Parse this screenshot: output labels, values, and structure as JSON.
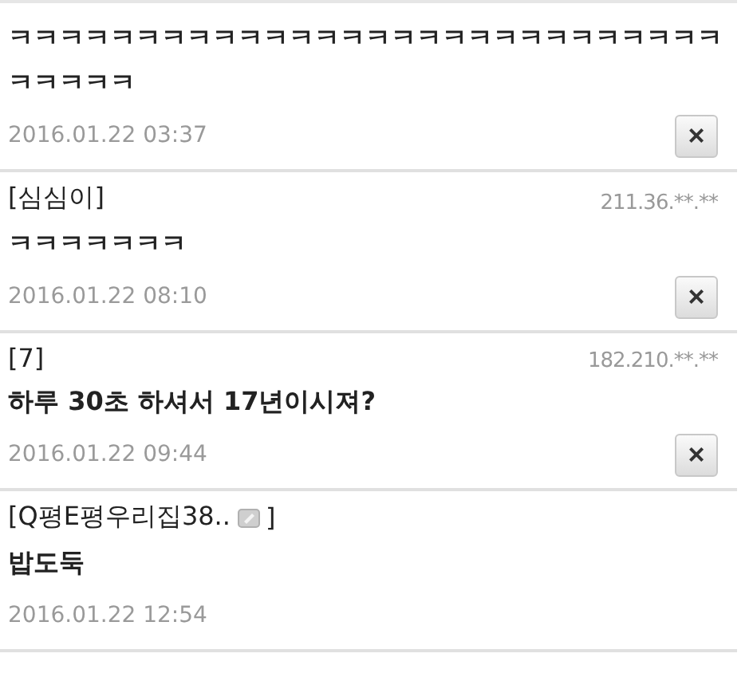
{
  "comments": [
    {
      "body": "ㅋㅋㅋㅋㅋㅋㅋㅋㅋㅋㅋㅋㅋㅋㅋㅋㅋㅋㅋㅋㅋㅋㅋㅋㅋㅋㅋㅋㅋㅋㅋㅋㅋ",
      "date": "2016.01.22 03:37",
      "delete_button": "×"
    },
    {
      "author": "[심심이]",
      "ip": "211.36.**.**",
      "body": "ㅋㅋㅋㅋㅋㅋㅋ",
      "date": "2016.01.22 08:10",
      "delete_button": "×"
    },
    {
      "author": "[7]",
      "ip": "182.210.**.**",
      "body": "하루 30초 하셔서 17년이시져?",
      "date": "2016.01.22 09:44",
      "delete_button": "×"
    },
    {
      "author": "[Q평E평우리집38..",
      "member_icon": true,
      "author_suffix": "]",
      "body": "밥도둑",
      "date": "2016.01.22 12:54"
    }
  ]
}
